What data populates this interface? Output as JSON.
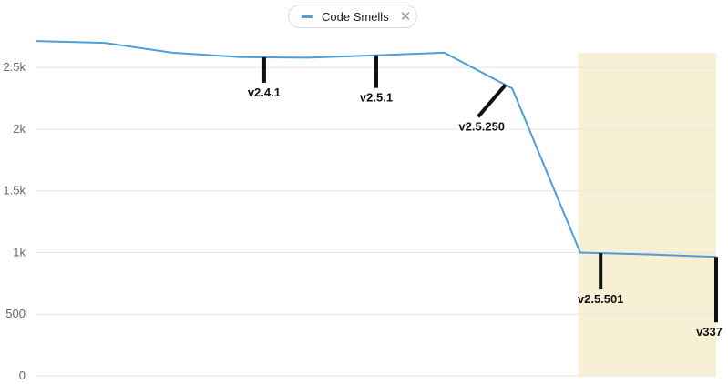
{
  "legend": {
    "label": "Code Smells",
    "close_glyph": "✕",
    "close_icon": "close-icon",
    "color": "#4b9fd5"
  },
  "colors": {
    "line": "#4b9fd5",
    "highlight": "#f8f0d4",
    "grid": "#e6e6e6",
    "marker": "#111111"
  },
  "chart_data": {
    "type": "line",
    "series": [
      {
        "name": "Code Smells",
        "values": [
          2715,
          2700,
          2620,
          2585,
          2580,
          2600,
          2620,
          2330,
          1000,
          985,
          965
        ]
      }
    ],
    "x": [
      0,
      1,
      2,
      3,
      4,
      5,
      6,
      7,
      8,
      9,
      10
    ],
    "yticks": [
      0,
      500,
      1000,
      1500,
      2000,
      2500
    ],
    "ytick_labels": [
      "0",
      "500",
      "1k",
      "1.5k",
      "2k",
      "2.5k"
    ],
    "ylim": [
      0,
      2900
    ],
    "grid": true,
    "legend_position": "top-center",
    "highlight_range": [
      8,
      10
    ],
    "events": [
      {
        "label": "v2.4.1",
        "x": 3.35
      },
      {
        "label": "v2.5.1",
        "x": 5.0
      },
      {
        "label": "v2.5.250",
        "x": 6.9
      },
      {
        "label": "v2.5.501",
        "x": 8.3
      },
      {
        "label": "v337",
        "x": 10.0
      }
    ]
  }
}
